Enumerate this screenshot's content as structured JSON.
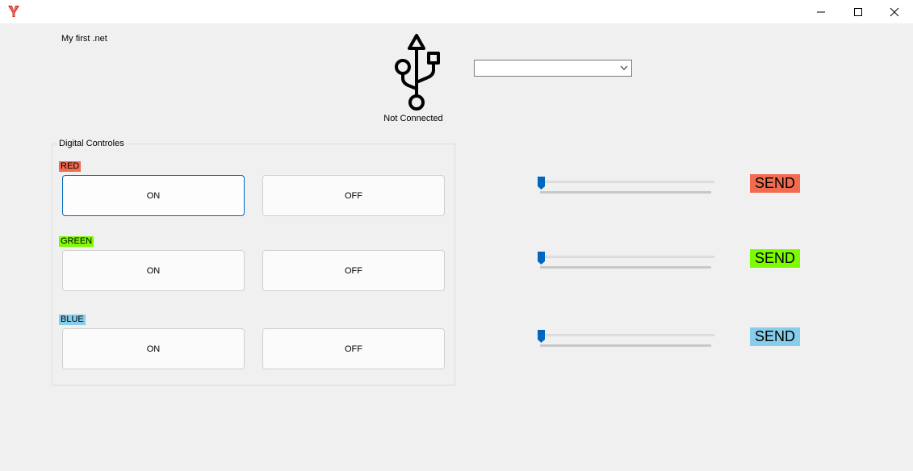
{
  "window": {
    "app_icon": "y-logo-icon",
    "minimize_icon": "minimize-icon",
    "maximize_icon": "maximize-icon",
    "close_icon": "close-icon"
  },
  "form": {
    "caption_label": "My first .net",
    "usb_icon": "usb-icon",
    "connection_status": "Not Connected",
    "port_select": {
      "value": "",
      "arrow_icon": "chevron-down-icon"
    }
  },
  "digital": {
    "title": "Digital Controles",
    "rows": [
      {
        "label": "RED",
        "color": "#f26b4f",
        "on": "ON",
        "off": "OFF"
      },
      {
        "label": "GREEN",
        "color": "#7cfc00",
        "on": "ON",
        "off": "OFF"
      },
      {
        "label": "BLUE",
        "color": "#87ceeb",
        "on": "ON",
        "off": "OFF"
      }
    ]
  },
  "analog": {
    "rows": [
      {
        "slider_value": 0,
        "send_label": "SEND",
        "color": "#f26b4f"
      },
      {
        "slider_value": 0,
        "send_label": "SEND",
        "color": "#7cfc00"
      },
      {
        "slider_value": 0,
        "send_label": "SEND",
        "color": "#87ceeb"
      }
    ]
  },
  "colors": {
    "accent": "#0067c0",
    "background": "#f0f0f0"
  }
}
